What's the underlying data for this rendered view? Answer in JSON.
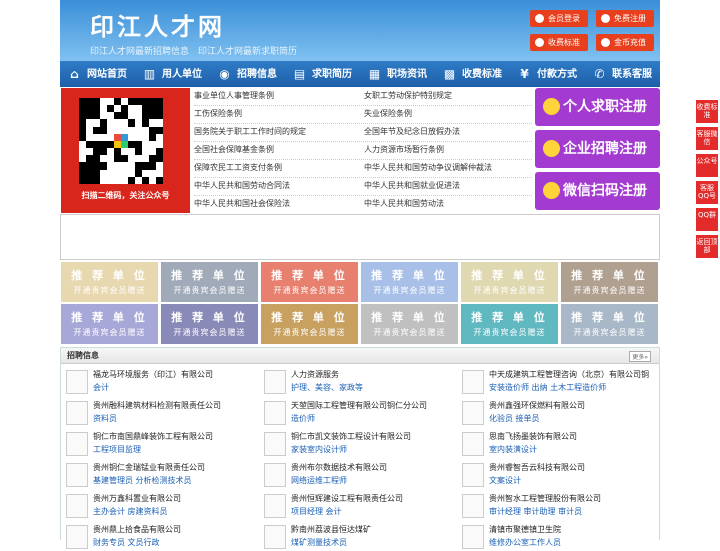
{
  "header": {
    "logo": "印江人才网",
    "subtitle": "印江人才网最新招聘信息　印江人才网最新求职简历",
    "buttons": [
      {
        "label": "会员登录"
      },
      {
        "label": "免费注册"
      },
      {
        "label": "收费标准"
      },
      {
        "label": "金币充值"
      }
    ]
  },
  "nav": [
    {
      "label": "网站首页",
      "icon": "home-icon"
    },
    {
      "label": "用人单位",
      "icon": "building-icon"
    },
    {
      "label": "招聘信息",
      "icon": "megaphone-icon"
    },
    {
      "label": "求职简历",
      "icon": "resume-icon"
    },
    {
      "label": "职场资讯",
      "icon": "news-icon"
    },
    {
      "label": "收费标准",
      "icon": "coins-icon"
    },
    {
      "label": "付款方式",
      "icon": "yen-icon"
    },
    {
      "label": "联系客服",
      "icon": "phone-icon"
    }
  ],
  "qr": {
    "caption": "扫描二维码，关注公众号"
  },
  "laws_left": [
    "事业单位人事管理条例",
    "工伤保险条例",
    "国务院关于职工工作时间的规定",
    "全国社会保障基金条例",
    "保障农民工工资支付条例",
    "中华人民共和国劳动合同法",
    "中华人民共和国社会保险法"
  ],
  "laws_right": [
    "女职工劳动保护特别规定",
    "失业保险条例",
    "全国年节及纪念日放假办法",
    "人力资源市场暂行条例",
    "中华人民共和国劳动争议调解仲裁法",
    "中华人民共和国就业促进法",
    "中华人民共和国劳动法"
  ],
  "register": [
    {
      "label": "个人求职注册",
      "icon": "person-icon"
    },
    {
      "label": "企业招聘注册",
      "icon": "company-icon"
    },
    {
      "label": "微信扫码注册",
      "icon": "wechat-icon"
    }
  ],
  "tiles": {
    "title": "推 荐 单 位",
    "sub": "开通贵宾会员赠送"
  },
  "tile_colors": [
    "#e8d8b0",
    "#a0aab8",
    "#e88070",
    "#a8c0e8",
    "#e0d8b0",
    "#b0a090",
    "#a8a8d8",
    "#8a8ab8",
    "#c8a060",
    "#c0c0c0",
    "#60b8c0",
    "#a8b8c8"
  ],
  "jobs": {
    "title": "招聘信息",
    "more": "更多»",
    "items": [
      {
        "company": "福龙马环境服务（印江）有限公司",
        "positions": "会计"
      },
      {
        "company": "人力资源服务",
        "positions": "护理、美容、家政等"
      },
      {
        "company": "中天成建筑工程管理咨询（北京）有限公司铜",
        "positions": "安装造价师 出纳 土木工程造价师"
      },
      {
        "company": "贵州融科建筑材料检测有限责任公司",
        "positions": "资料员"
      },
      {
        "company": "天堃国际工程管理有限公司铜仁分公司",
        "positions": "造价师"
      },
      {
        "company": "贵州鑫强环保燃料有限公司",
        "positions": "化验员 接单员"
      },
      {
        "company": "铜仁市南国鼎峰装饰工程有限公司",
        "positions": "工程项目监理"
      },
      {
        "company": "铜仁市凯文装饰工程设计有限公司",
        "positions": "家装室内设计师"
      },
      {
        "company": "思南飞扬墨装饰有限公司",
        "positions": "室内装潢设计"
      },
      {
        "company": "贵州铜仁金瑞锰业有限责任公司",
        "positions": "基建管理员 分析检测技术员"
      },
      {
        "company": "贵州布尔数据技术有限公司",
        "positions": "网络运维工程师"
      },
      {
        "company": "贵州睿智吾云科技有限公司",
        "positions": "文案设计"
      },
      {
        "company": "贵州万鑫科置业有限公司",
        "positions": "主办会计 房建资料员"
      },
      {
        "company": "贵州恒辉建设工程有限责任公司",
        "positions": "项目经理 会计"
      },
      {
        "company": "贵州智水工程管理股份有限公司",
        "positions": "审计经理 审计助理 审计员"
      },
      {
        "company": "贵州鼎上拾食品有限公司",
        "positions": "财务专员 文员行政"
      },
      {
        "company": "黔南州荔波县恒达煤矿",
        "positions": "煤矿测量技术员"
      },
      {
        "company": "清镇市聚德镇卫生院",
        "positions": "维修办公室工作人员"
      }
    ]
  },
  "side": [
    "收费标准",
    "客服微信",
    "公众号",
    "客服QQ号",
    "QQ群",
    "返回顶部"
  ]
}
